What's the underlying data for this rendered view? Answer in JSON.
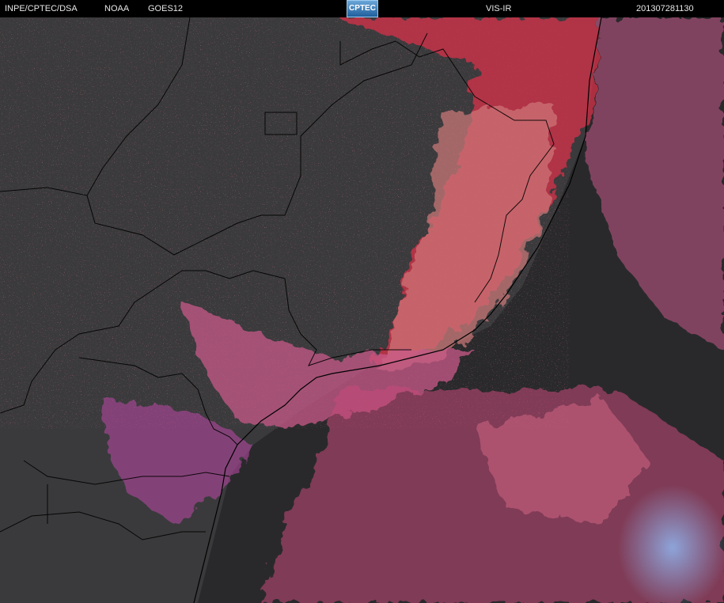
{
  "header": {
    "agency": "INPE/CPTEC/DSA",
    "source": "NOAA",
    "satellite": "GOES12",
    "logo_text": "CPTEC",
    "channel": "VIS-IR",
    "timestamp": "201307281130"
  },
  "colors": {
    "background": "#000000",
    "land": "#3a3a3c",
    "ocean": "#2a2a2c",
    "cloud_red": "#d8304a",
    "cloud_pink": "#c85a8a",
    "cloud_magenta": "#b34a9e",
    "cloud_cyan": "#7aa0d8",
    "border_lines": "#000000"
  }
}
